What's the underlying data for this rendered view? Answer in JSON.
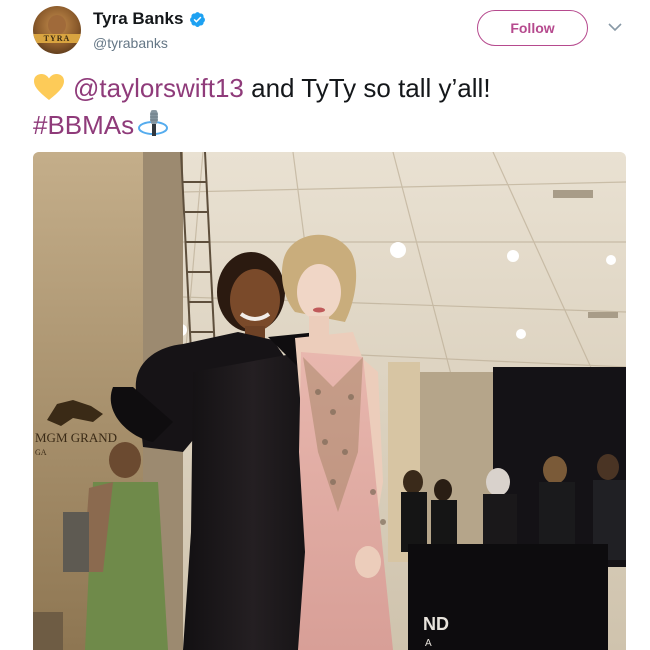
{
  "user": {
    "display_name": "Tyra Banks",
    "handle": "@tyrabanks",
    "avatar_text": "TYRA",
    "verified": true
  },
  "follow_label": "Follow",
  "accent_color": "#b64a8e",
  "tweet": {
    "emoji_start": "yellow-heart",
    "mention": "@taylorswift13",
    "text_after_mention": " and TyTy so tall y’all!",
    "hashtag": "#BBMAs",
    "emoji_end": "microphone"
  },
  "photo": {
    "signage": [
      "MGM GRAND",
      "GA",
      "ND",
      "A"
    ]
  }
}
